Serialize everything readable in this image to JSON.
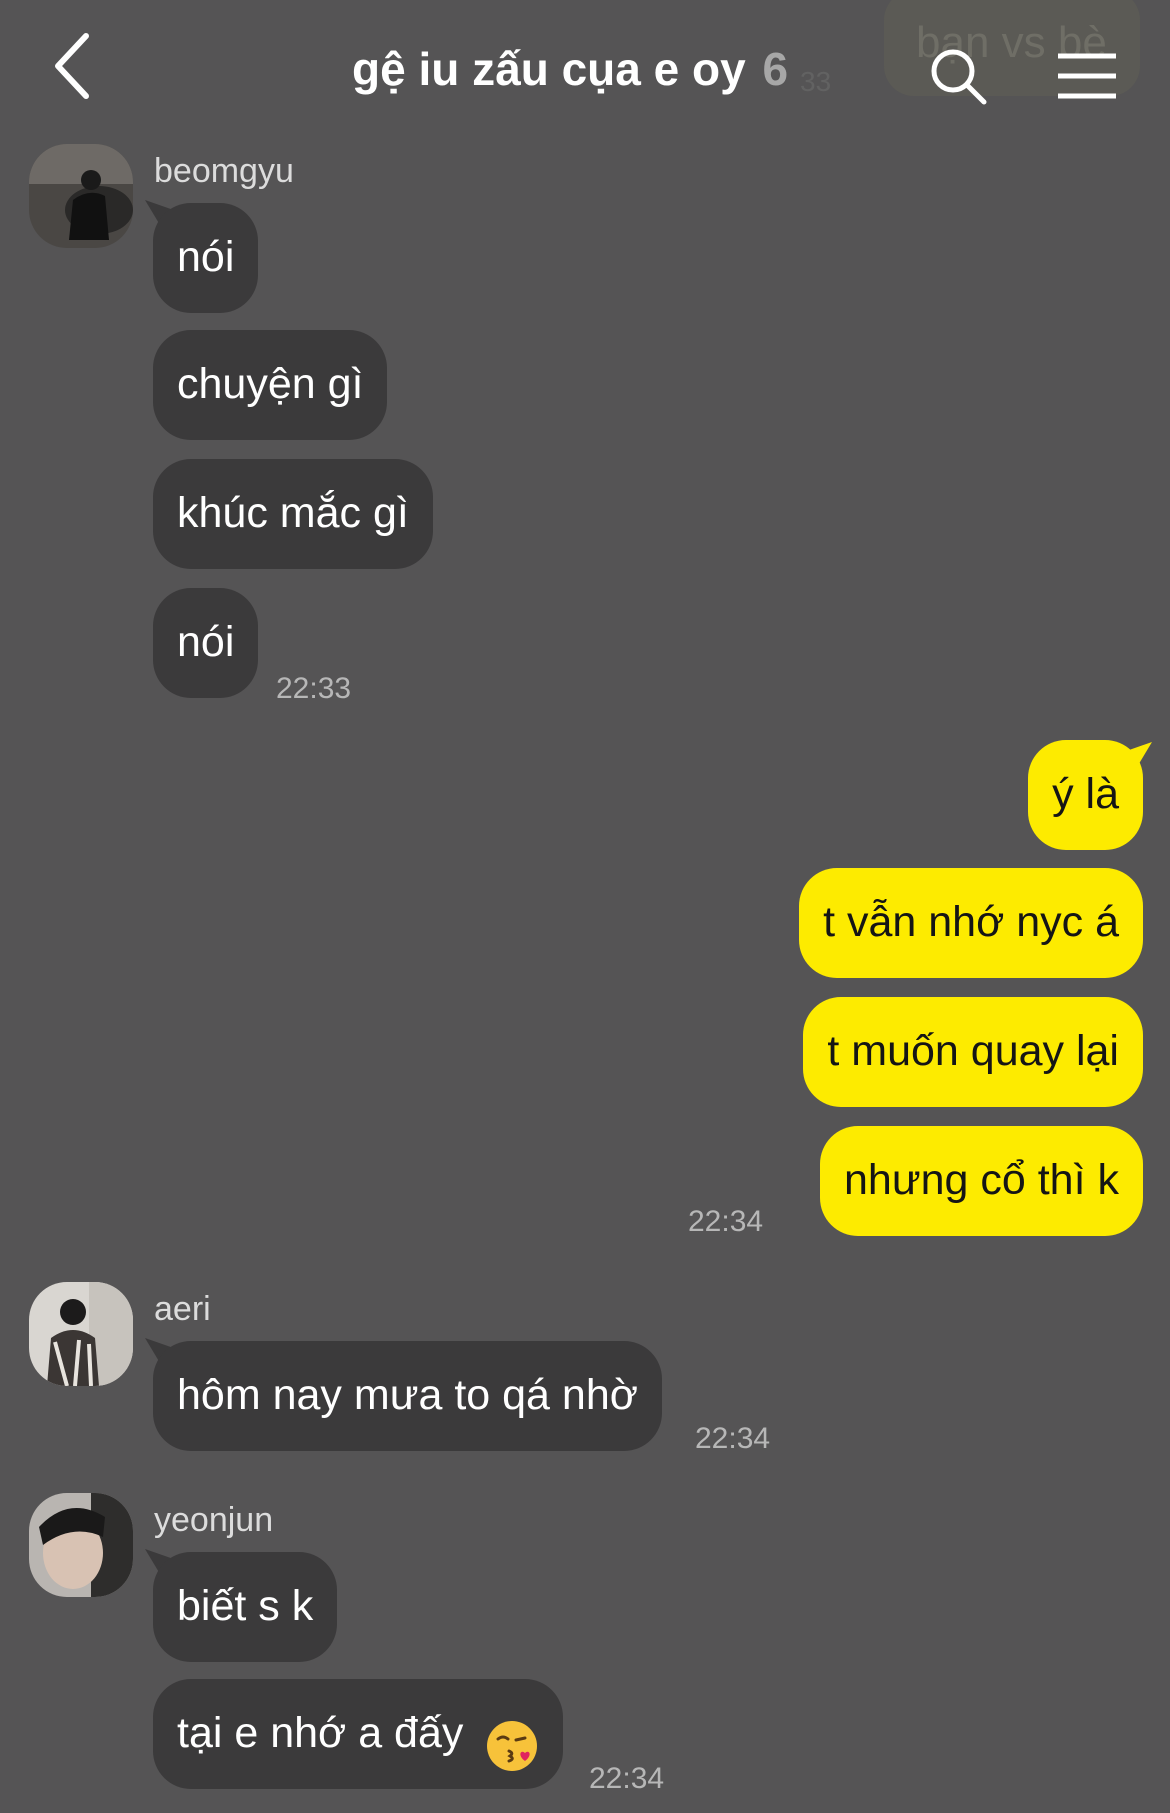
{
  "header": {
    "back_icon": "chevron-left-icon",
    "title": "gệ iu zấu cụa e oy",
    "member_count": "6",
    "search_icon": "search-icon",
    "menu_icon": "hamburger-menu-icon",
    "background_overlay": {
      "bubble_text": "bạn vs bè",
      "time_text": "33"
    }
  },
  "colors": {
    "background": "#555455",
    "incoming_bubble": "#3b3a3b",
    "outgoing_bubble": "#fdeb00"
  },
  "messages": [
    {
      "sender": "beomgyu",
      "avatar": "avatar-beomgyu",
      "texts": [
        "nói",
        "chuyện gì",
        "khúc mắc gì",
        "nói"
      ],
      "time": "22:33"
    },
    {
      "sender": "me",
      "texts": [
        "ý là",
        "t vẫn nhớ nyc á",
        "t muốn quay lại",
        "nhưng cổ thì k"
      ],
      "time": "22:34"
    },
    {
      "sender": "aeri",
      "avatar": "avatar-aeri",
      "texts": [
        "hôm nay mưa to qá nhờ"
      ],
      "time": "22:34"
    },
    {
      "sender": "yeonjun",
      "avatar": "avatar-yeonjun",
      "texts": [
        "biết s k",
        "tại e nhớ a đấy"
      ],
      "emoji": "kissing-face-emoji",
      "time": "22:34"
    }
  ]
}
